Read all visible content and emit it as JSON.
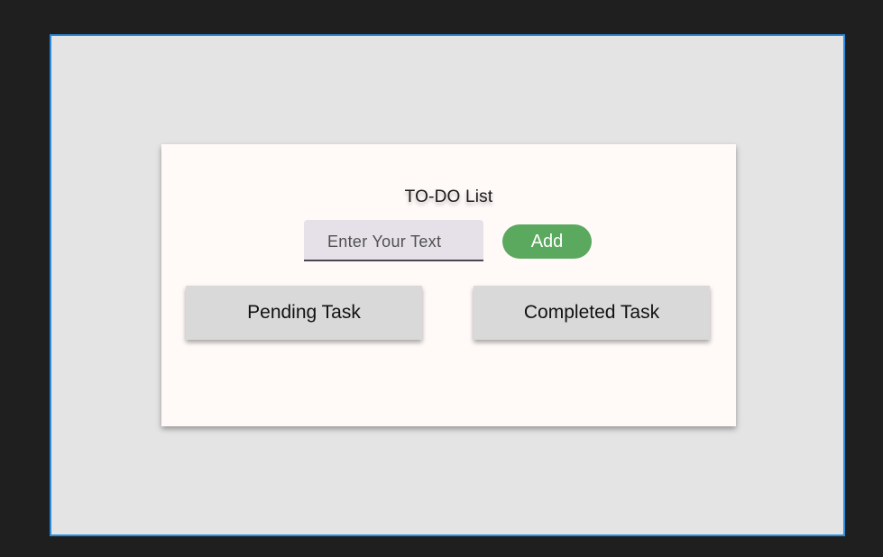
{
  "app": {
    "title": "TO-DO List"
  },
  "input": {
    "placeholder": "Enter Your Text",
    "value": ""
  },
  "buttons": {
    "add_label": "Add",
    "pending_label": "Pending Task",
    "completed_label": "Completed Task"
  },
  "colors": {
    "frame_border": "#2b8ce0",
    "add_button": "#5ba95e",
    "input_background": "#e6e1e8",
    "tab_background": "#d9d9d9"
  }
}
